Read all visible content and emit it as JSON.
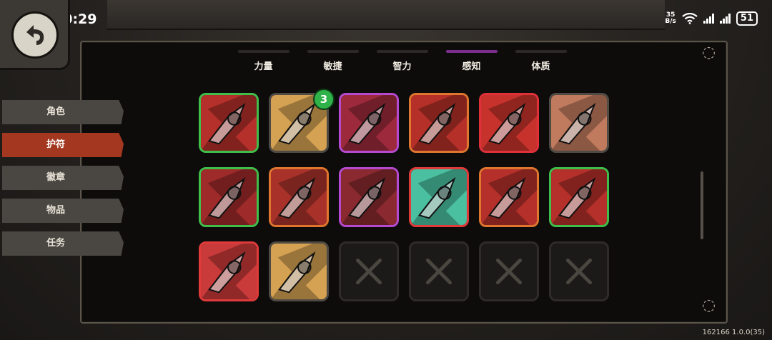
{
  "status_bar": {
    "time": "00:29",
    "net_speed_value": "35",
    "net_speed_unit": "B/s",
    "battery": "51",
    "icons": [
      "wifi-icon",
      "signal-icon",
      "signal-icon",
      "battery-icon"
    ]
  },
  "back_button": {
    "icon": "back-arrow-icon"
  },
  "tabs": [
    {
      "label": "力量",
      "active": false
    },
    {
      "label": "敏捷",
      "active": false
    },
    {
      "label": "智力",
      "active": false
    },
    {
      "label": "感知",
      "active": true
    },
    {
      "label": "体质",
      "active": false
    }
  ],
  "side_menu": [
    {
      "label": "角色",
      "active": false
    },
    {
      "label": "护符",
      "active": true
    },
    {
      "label": "徽章",
      "active": false
    },
    {
      "label": "物品",
      "active": false
    },
    {
      "label": "任务",
      "active": false
    }
  ],
  "charms": [
    {
      "name": "red-arrow-charm-icon",
      "border": "#3fbf4a",
      "bg": "#b5302a"
    },
    {
      "name": "cracked-earth-charm-icon",
      "border": "#4f4a44",
      "bg": "#d5a152",
      "badge": "3"
    },
    {
      "name": "grabbing-hand-charm-icon",
      "border": "#b54ad0",
      "bg": "#9d2a3c"
    },
    {
      "name": "green-spear-charm-icon",
      "border": "#e0752e",
      "bg": "#b53028"
    },
    {
      "name": "masked-face-charm-icon",
      "border": "#e0303a",
      "bg": "#c8322c"
    },
    {
      "name": "shell-ammo-charm-icon",
      "border": "#4f4a44",
      "bg": "#c07a5e"
    },
    {
      "name": "pink-swirl-charm-icon",
      "border": "#3fbf4a",
      "bg": "#9e2a2a"
    },
    {
      "name": "golden-helm-charm-icon",
      "border": "#e0752e",
      "bg": "#a8322a"
    },
    {
      "name": "spear-tip-charm-icon",
      "border": "#b54ad0",
      "bg": "#8a2a30"
    },
    {
      "name": "teal-claw-charm-icon",
      "border": "#e03a3a",
      "bg": "#4ac0a0"
    },
    {
      "name": "fang-tooth-charm-icon",
      "border": "#e0752e",
      "bg": "#b5302a"
    },
    {
      "name": "dark-hand-charm-icon",
      "border": "#3fbf4a",
      "bg": "#b5302a"
    },
    {
      "name": "lightning-swirl-charm-icon",
      "border": "#e03a3a",
      "bg": "#c93a3a"
    },
    {
      "name": "rising-sun-charm-icon",
      "border": "#4f4a44",
      "bg": "#d5a152"
    },
    {
      "name": "empty-slot",
      "empty": true
    },
    {
      "name": "empty-slot",
      "empty": true
    },
    {
      "name": "empty-slot",
      "empty": true
    },
    {
      "name": "empty-slot",
      "empty": true
    }
  ],
  "version": "162166 1.0.0(35)"
}
